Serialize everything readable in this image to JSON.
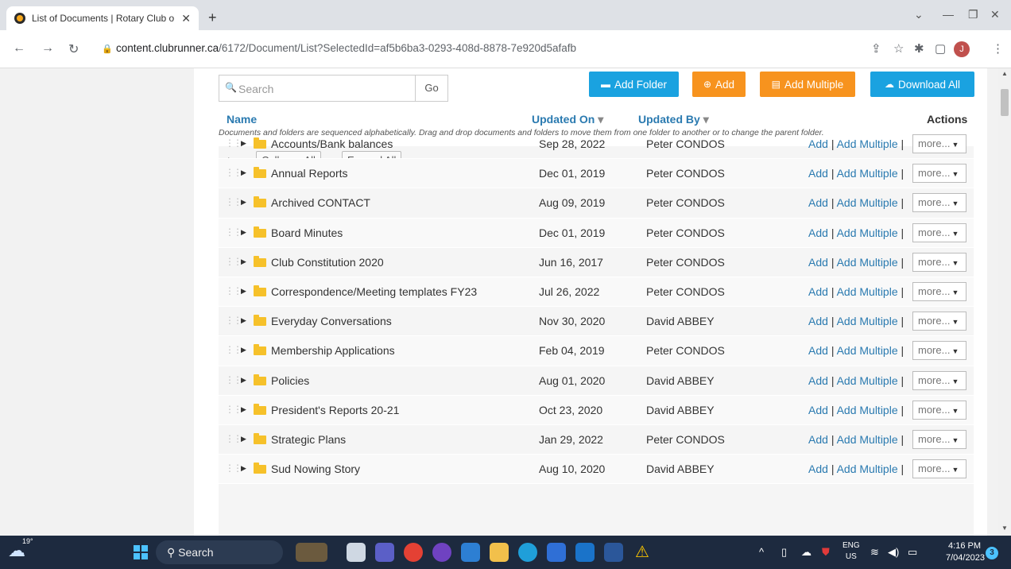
{
  "browser": {
    "tab_title": "List of Documents | Rotary Club o",
    "new_tab": "+",
    "url_host": "content.clubrunner.ca",
    "url_path": "/6172/Document/List?SelectedId=af5b6ba3-0293-408d-8878-7e920d5afafb",
    "avatar_initial": "J"
  },
  "toolbar": {
    "search_placeholder": "Search",
    "go_label": "Go",
    "add_folder_label": "Add Folder",
    "add_label": "Add",
    "add_multiple_label": "Add Multiple",
    "download_all_label": "Download All"
  },
  "note": "Documents and folders are sequenced alphabetically. Drag and drop documents and folders to move them from one folder to another or to change the parent folder.",
  "controls": {
    "collapse_all": "Collapse All",
    "expand_all": "Expand All"
  },
  "columns": {
    "name": "Name",
    "updated_on": "Updated On",
    "updated_by": "Updated By",
    "actions": "Actions",
    "sort_glyph": "▾"
  },
  "row_actions": {
    "add": "Add",
    "sep": "|",
    "add_multiple": "Add Multiple",
    "more": "more..."
  },
  "rows": [
    {
      "name": "Accounts/Bank balances",
      "date": "Sep 28, 2022",
      "by": "Peter CONDOS"
    },
    {
      "name": "Annual Reports",
      "date": "Dec 01, 2019",
      "by": "Peter CONDOS"
    },
    {
      "name": "Archived CONTACT",
      "date": "Aug 09, 2019",
      "by": "Peter CONDOS"
    },
    {
      "name": "Board Minutes",
      "date": "Dec 01, 2019",
      "by": "Peter CONDOS"
    },
    {
      "name": "Club Constitution 2020",
      "date": "Jun 16, 2017",
      "by": "Peter CONDOS"
    },
    {
      "name": "Correspondence/Meeting templates FY23",
      "date": "Jul 26, 2022",
      "by": "Peter CONDOS"
    },
    {
      "name": "Everyday Conversations",
      "date": "Nov 30, 2020",
      "by": "David ABBEY"
    },
    {
      "name": "Membership Applications",
      "date": "Feb 04, 2019",
      "by": "Peter CONDOS"
    },
    {
      "name": "Policies",
      "date": "Aug 01, 2020",
      "by": "David ABBEY"
    },
    {
      "name": "President's Reports 20-21",
      "date": "Oct 23, 2020",
      "by": "David ABBEY"
    },
    {
      "name": "Strategic Plans",
      "date": "Jan 29, 2022",
      "by": "Peter CONDOS"
    },
    {
      "name": "Sud Nowing Story",
      "date": "Aug 10, 2020",
      "by": "David ABBEY"
    }
  ],
  "taskbar": {
    "temperature": "19°",
    "search_label": "Search",
    "lang_top": "ENG",
    "lang_bottom": "US",
    "time": "4:16 PM",
    "date": "7/04/2023",
    "notification_count": "3"
  },
  "colors": {
    "accent_blue": "#1aa2e0",
    "accent_orange": "#f7931e",
    "link_blue": "#2a7ab0",
    "folder_yellow": "#f6c12a"
  }
}
